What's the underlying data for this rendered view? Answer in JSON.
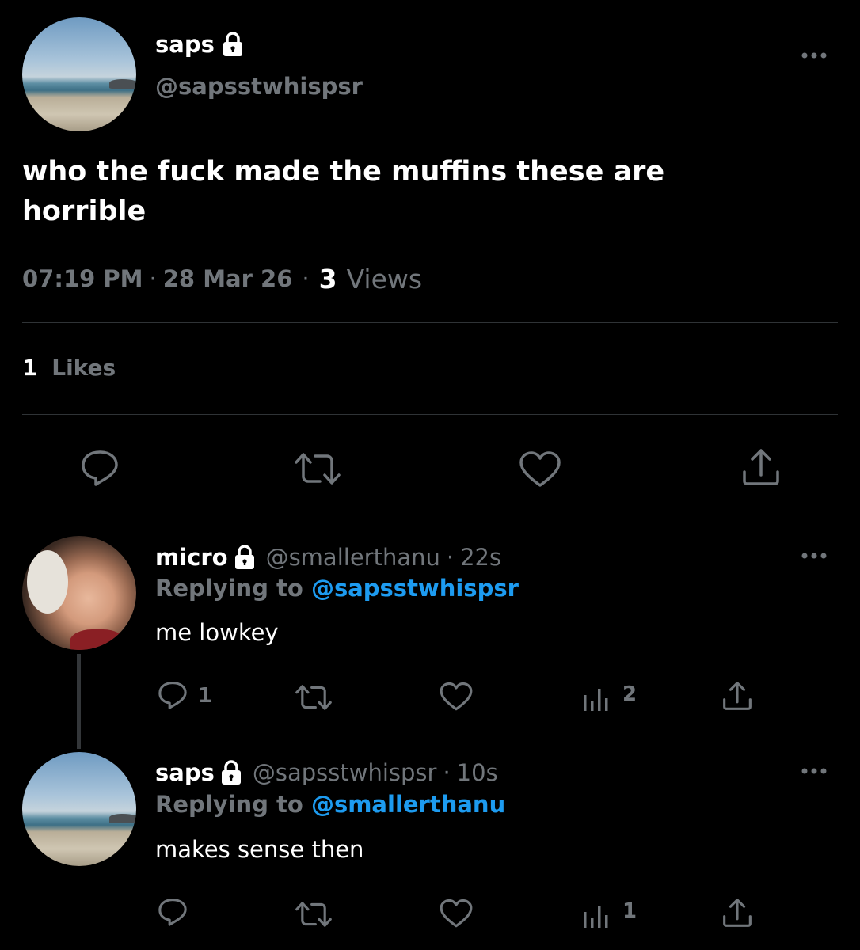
{
  "main_tweet": {
    "display_name": "saps",
    "handle": "@sapsstwhispsr",
    "text_line1": "who the fuck made the muffins these are",
    "text_line2": "horrible",
    "time": "07:19 PM",
    "date": "28 Mar 26",
    "views_count": "3",
    "views_label": "Views",
    "likes_count": "1",
    "likes_label": "Likes"
  },
  "replies": [
    {
      "display_name": "micro",
      "handle": "@smallerthanu",
      "age": "22s",
      "replying_label": "Replying to",
      "replying_handle": "@sapsstwhispsr",
      "text": "me lowkey",
      "reply_count": "1",
      "views_count": "2"
    },
    {
      "display_name": "saps",
      "handle": "@sapsstwhispsr",
      "age": "10s",
      "replying_label": "Replying to",
      "replying_handle": "@smallerthanu",
      "text": "makes sense then",
      "reply_count": "",
      "views_count": "1"
    }
  ],
  "separator": "·",
  "icons": [
    "lock-icon",
    "more-icon",
    "reply-icon",
    "retweet-icon",
    "like-icon",
    "views-icon",
    "share-icon"
  ],
  "colors": {
    "background": "#000000",
    "text": "#ffffff",
    "muted": "#71767b",
    "link": "#1d9bf0",
    "divider": "#2f3336"
  }
}
